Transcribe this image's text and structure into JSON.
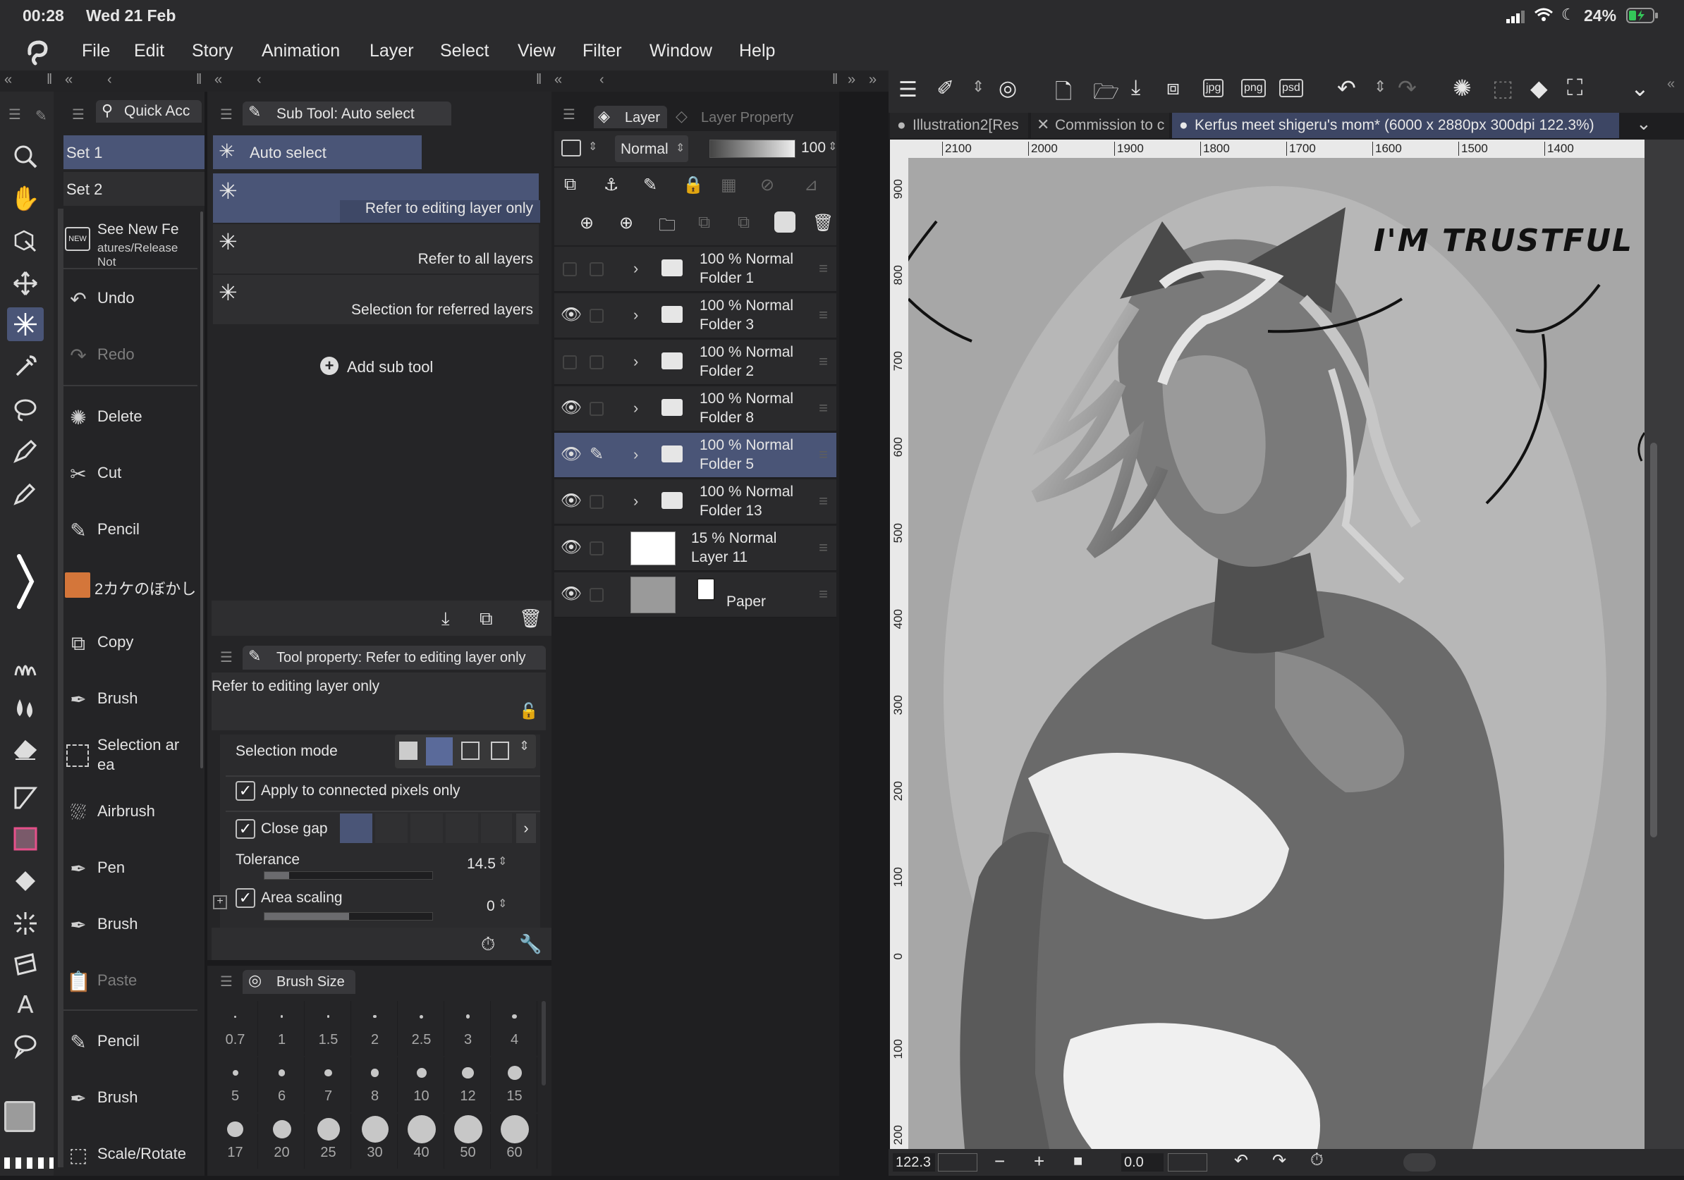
{
  "status": {
    "time": "00:28",
    "date": "Wed 21 Feb",
    "battery": "24%"
  },
  "menu": [
    "File",
    "Edit",
    "Story",
    "Animation",
    "Layer",
    "Select",
    "View",
    "Filter",
    "Window",
    "Help"
  ],
  "quick_access": {
    "tab_label": "Quick Acc",
    "sets": [
      "Set 1",
      "Set 2"
    ],
    "items": [
      {
        "label": "See New Fe",
        "label2": "atures/Release Not",
        "icon": "new-badge-icon",
        "disabled": false
      },
      {
        "label": "Undo",
        "icon": "undo-icon",
        "disabled": false
      },
      {
        "label": "Redo",
        "icon": "redo-icon",
        "disabled": true
      },
      {
        "label": "Delete",
        "icon": "delete-icon",
        "disabled": false
      },
      {
        "label": "Cut",
        "icon": "scissors-icon",
        "disabled": false
      },
      {
        "label": "Pencil",
        "icon": "pencil-icon",
        "disabled": false
      },
      {
        "label": "2カケのぼかし",
        "icon": "brush-thumb-icon",
        "disabled": false
      },
      {
        "label": "Copy",
        "icon": "copy-icon",
        "disabled": false
      },
      {
        "label": "Brush",
        "icon": "brush-icon",
        "disabled": false
      },
      {
        "label": "Selection ar",
        "label2": "ea",
        "icon": "selection-area-icon",
        "disabled": false
      },
      {
        "label": "Airbrush",
        "icon": "airbrush-icon",
        "disabled": false
      },
      {
        "label": "Pen",
        "icon": "pen-icon",
        "disabled": false
      },
      {
        "label": "Brush",
        "icon": "brush-icon",
        "disabled": false
      },
      {
        "label": "Paste",
        "icon": "paste-icon",
        "disabled": true
      },
      {
        "label": "Pencil",
        "icon": "pencil-icon",
        "disabled": false
      },
      {
        "label": "Brush",
        "icon": "brush-icon",
        "disabled": false
      },
      {
        "label": "Scale/Rotate",
        "icon": "scale-rotate-icon",
        "disabled": false
      }
    ]
  },
  "subtool": {
    "header": "Sub Tool: Auto select",
    "group": "Auto select",
    "items": [
      "Refer to editing layer only",
      "Refer to all layers",
      "Selection for referred layers"
    ],
    "add_label": "Add sub tool"
  },
  "tool_property": {
    "header": "Tool property: Refer to editing layer only",
    "preset": "Refer to editing layer only",
    "selection_mode_label": "Selection mode",
    "connected_label": "Apply to connected pixels only",
    "close_gap_label": "Close gap",
    "tolerance_label": "Tolerance",
    "tolerance_value": "14.5",
    "area_scaling_label": "Area scaling",
    "area_scaling_value": "0"
  },
  "brush_size": {
    "header": "Brush Size",
    "sizes": [
      "0.7",
      "1",
      "1.5",
      "2",
      "2.5",
      "3",
      "4",
      "5",
      "6",
      "7",
      "8",
      "10",
      "12",
      "15",
      "17",
      "20",
      "25",
      "30",
      "40",
      "50",
      "60"
    ]
  },
  "layer_panel": {
    "tab_layer": "Layer",
    "tab_property": "Layer Property",
    "blend_mode": "Normal",
    "opacity": "100",
    "layers": [
      {
        "opacity": "100 %",
        "mode": "Normal",
        "name": "Folder 1",
        "visible": false,
        "type": "folder",
        "selected": false
      },
      {
        "opacity": "100 %",
        "mode": "Normal",
        "name": "Folder 3",
        "visible": true,
        "type": "folder",
        "selected": false
      },
      {
        "opacity": "100 %",
        "mode": "Normal",
        "name": "Folder 2",
        "visible": false,
        "type": "folder",
        "selected": false
      },
      {
        "opacity": "100 %",
        "mode": "Normal",
        "name": "Folder 8",
        "visible": true,
        "type": "folder",
        "selected": false
      },
      {
        "opacity": "100 %",
        "mode": "Normal",
        "name": "Folder 5",
        "visible": true,
        "type": "folder",
        "selected": true
      },
      {
        "opacity": "100 %",
        "mode": "Normal",
        "name": "Folder 13",
        "visible": true,
        "type": "folder",
        "selected": false
      },
      {
        "opacity": "15 %",
        "mode": "Normal",
        "name": "Layer 11",
        "visible": true,
        "type": "raster",
        "selected": false
      },
      {
        "opacity": "",
        "mode": "",
        "name": "Paper",
        "visible": true,
        "type": "paper",
        "selected": false
      }
    ]
  },
  "canvas": {
    "tabs": [
      "Illustration2[Res",
      "Commission to c",
      "Kerfus meet shigeru's mom* (6000 x 2880px 300dpi 122.3%)"
    ],
    "top_ruler": [
      "2100",
      "2000",
      "1900",
      "1800",
      "1700",
      "1600",
      "1500",
      "1400"
    ],
    "left_ruler": [
      "900",
      "800",
      "700",
      "600",
      "500",
      "400",
      "300",
      "200",
      "100",
      "0",
      "100",
      "200"
    ],
    "speech_text": "I'M TRUSTFUL",
    "zoom": "122.3",
    "rotation": "0.0"
  },
  "colors": {
    "accent": "#4a5577",
    "panel": "#252527",
    "canvas_bg": "#a7a7a7"
  }
}
